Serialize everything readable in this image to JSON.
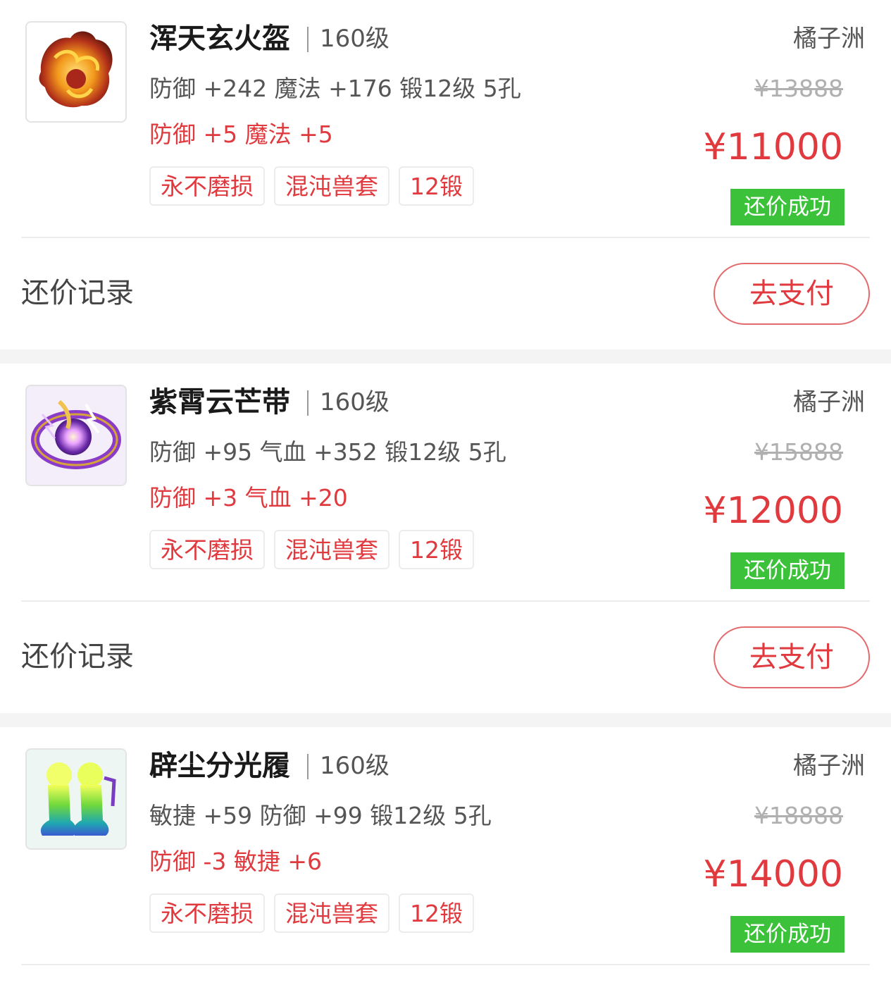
{
  "items": [
    {
      "name": "浑天玄火盔",
      "level": "160级",
      "server": "橘子洲",
      "stats": "防御 +242 魔法 +176  锻12级  5孔",
      "bonus": "防御 +5 魔法 +5",
      "tags": [
        "永不磨损",
        "混沌兽套",
        "12锻"
      ],
      "original_price": "¥13888",
      "price": "¥11000",
      "status": "还价成功",
      "record_label": "还价记录",
      "pay_label": "去支付",
      "icon": "helmet-icon"
    },
    {
      "name": "紫霄云芒带",
      "level": "160级",
      "server": "橘子洲",
      "stats": "防御 +95 气血 +352  锻12级  5孔",
      "bonus": "防御 +3 气血 +20",
      "tags": [
        "永不磨损",
        "混沌兽套",
        "12锻"
      ],
      "original_price": "¥15888",
      "price": "¥12000",
      "status": "还价成功",
      "record_label": "还价记录",
      "pay_label": "去支付",
      "icon": "belt-icon"
    },
    {
      "name": "辟尘分光履",
      "level": "160级",
      "server": "橘子洲",
      "stats": "敏捷 +59 防御 +99  锻12级  5孔",
      "bonus": "防御 -3 敏捷 +6",
      "tags": [
        "永不磨损",
        "混沌兽套",
        "12锻"
      ],
      "original_price": "¥18888",
      "price": "¥14000",
      "status": "还价成功",
      "icon": "boots-icon"
    }
  ],
  "colors": {
    "accent_red": "#e0393e",
    "success_green": "#3cc13a",
    "background": "#f4f4f4"
  }
}
